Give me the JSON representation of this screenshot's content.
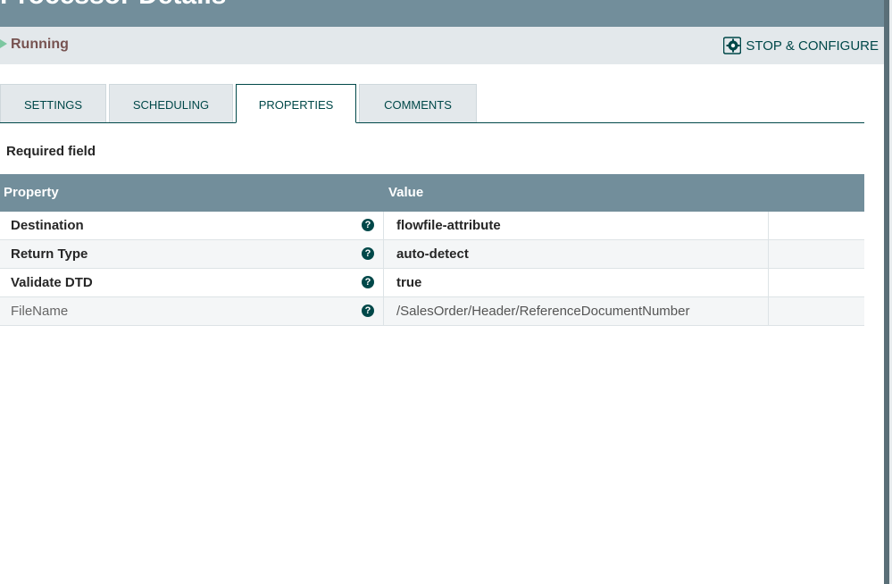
{
  "window": {
    "title": "Processor Details"
  },
  "status": {
    "state": "Running",
    "stop_configure_label": "STOP & CONFIGURE"
  },
  "tabs": [
    {
      "label": "SETTINGS",
      "selected": false
    },
    {
      "label": "SCHEDULING",
      "selected": false
    },
    {
      "label": "PROPERTIES",
      "selected": true
    },
    {
      "label": "COMMENTS",
      "selected": false
    }
  ],
  "required_note": "Required field",
  "table": {
    "headers": {
      "property": "Property",
      "value": "Value"
    },
    "rows": [
      {
        "name": "Destination",
        "value": "flowfile-attribute",
        "required": true
      },
      {
        "name": "Return Type",
        "value": "auto-detect",
        "required": true
      },
      {
        "name": "Validate DTD",
        "value": "true",
        "required": true
      },
      {
        "name": "FileName",
        "value": "/SalesOrder/Header/ReferenceDocumentNumber",
        "required": false
      }
    ]
  },
  "colors": {
    "header_bg": "#728e9b",
    "status_bg": "#e3e8eb",
    "accent": "#004849",
    "running": "#7dc7a0",
    "state_text": "#775351"
  }
}
